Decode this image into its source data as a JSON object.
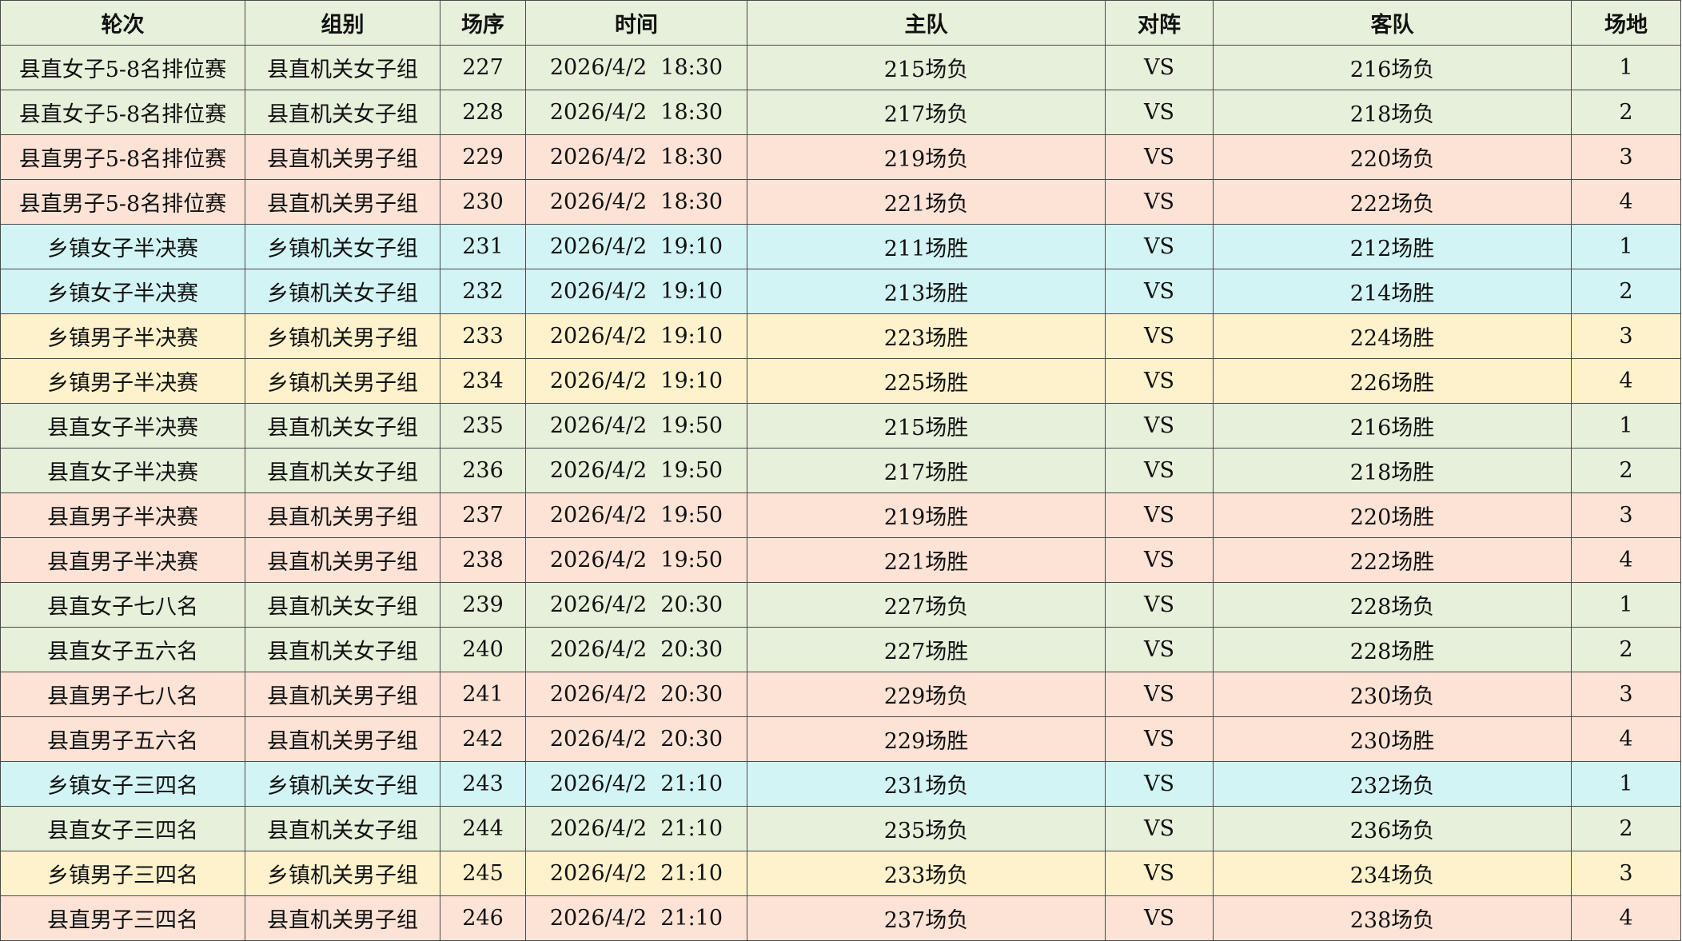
{
  "header": {
    "round": "轮次",
    "group": "组别",
    "match_no": "场序",
    "time": "时间",
    "home": "主队",
    "vs": "对阵",
    "away": "客队",
    "court": "场地"
  },
  "row_colors": {
    "xg-f": "#e6f0da",
    "xg-m": "#fce3d6",
    "xz-f": "#d3f4f4",
    "xz-m": "#fdf2cc"
  },
  "rows": [
    {
      "color": "xg-f",
      "round": "县直女子5-8名排位赛",
      "group": "县直机关女子组",
      "match_no": "227",
      "time": "2026/4/2  18:30",
      "home": "215场负",
      "vs": "VS",
      "away": "216场负",
      "court": "1"
    },
    {
      "color": "xg-f",
      "round": "县直女子5-8名排位赛",
      "group": "县直机关女子组",
      "match_no": "228",
      "time": "2026/4/2  18:30",
      "home": "217场负",
      "vs": "VS",
      "away": "218场负",
      "court": "2"
    },
    {
      "color": "xg-m",
      "round": "县直男子5-8名排位赛",
      "group": "县直机关男子组",
      "match_no": "229",
      "time": "2026/4/2  18:30",
      "home": "219场负",
      "vs": "VS",
      "away": "220场负",
      "court": "3"
    },
    {
      "color": "xg-m",
      "round": "县直男子5-8名排位赛",
      "group": "县直机关男子组",
      "match_no": "230",
      "time": "2026/4/2  18:30",
      "home": "221场负",
      "vs": "VS",
      "away": "222场负",
      "court": "4"
    },
    {
      "color": "xz-f",
      "round": "乡镇女子半决赛",
      "group": "乡镇机关女子组",
      "match_no": "231",
      "time": "2026/4/2  19:10",
      "home": "211场胜",
      "vs": "VS",
      "away": "212场胜",
      "court": "1"
    },
    {
      "color": "xz-f",
      "round": "乡镇女子半决赛",
      "group": "乡镇机关女子组",
      "match_no": "232",
      "time": "2026/4/2  19:10",
      "home": "213场胜",
      "vs": "VS",
      "away": "214场胜",
      "court": "2"
    },
    {
      "color": "xz-m",
      "round": "乡镇男子半决赛",
      "group": "乡镇机关男子组",
      "match_no": "233",
      "time": "2026/4/2  19:10",
      "home": "223场胜",
      "vs": "VS",
      "away": "224场胜",
      "court": "3"
    },
    {
      "color": "xz-m",
      "round": "乡镇男子半决赛",
      "group": "乡镇机关男子组",
      "match_no": "234",
      "time": "2026/4/2  19:10",
      "home": "225场胜",
      "vs": "VS",
      "away": "226场胜",
      "court": "4"
    },
    {
      "color": "xg-f",
      "round": "县直女子半决赛",
      "group": "县直机关女子组",
      "match_no": "235",
      "time": "2026/4/2  19:50",
      "home": "215场胜",
      "vs": "VS",
      "away": "216场胜",
      "court": "1"
    },
    {
      "color": "xg-f",
      "round": "县直女子半决赛",
      "group": "县直机关女子组",
      "match_no": "236",
      "time": "2026/4/2  19:50",
      "home": "217场胜",
      "vs": "VS",
      "away": "218场胜",
      "court": "2"
    },
    {
      "color": "xg-m",
      "round": "县直男子半决赛",
      "group": "县直机关男子组",
      "match_no": "237",
      "time": "2026/4/2  19:50",
      "home": "219场胜",
      "vs": "VS",
      "away": "220场胜",
      "court": "3"
    },
    {
      "color": "xg-m",
      "round": "县直男子半决赛",
      "group": "县直机关男子组",
      "match_no": "238",
      "time": "2026/4/2  19:50",
      "home": "221场胜",
      "vs": "VS",
      "away": "222场胜",
      "court": "4"
    },
    {
      "color": "xg-f",
      "round": "县直女子七八名",
      "group": "县直机关女子组",
      "match_no": "239",
      "time": "2026/4/2  20:30",
      "home": "227场负",
      "vs": "VS",
      "away": "228场负",
      "court": "1"
    },
    {
      "color": "xg-f",
      "round": "县直女子五六名",
      "group": "县直机关女子组",
      "match_no": "240",
      "time": "2026/4/2  20:30",
      "home": "227场胜",
      "vs": "VS",
      "away": "228场胜",
      "court": "2"
    },
    {
      "color": "xg-m",
      "round": "县直男子七八名",
      "group": "县直机关男子组",
      "match_no": "241",
      "time": "2026/4/2  20:30",
      "home": "229场负",
      "vs": "VS",
      "away": "230场负",
      "court": "3"
    },
    {
      "color": "xg-m",
      "round": "县直男子五六名",
      "group": "县直机关男子组",
      "match_no": "242",
      "time": "2026/4/2  20:30",
      "home": "229场胜",
      "vs": "VS",
      "away": "230场胜",
      "court": "4"
    },
    {
      "color": "xz-f",
      "round": "乡镇女子三四名",
      "group": "乡镇机关女子组",
      "match_no": "243",
      "time": "2026/4/2  21:10",
      "home": "231场负",
      "vs": "VS",
      "away": "232场负",
      "court": "1"
    },
    {
      "color": "xg-f",
      "round": "县直女子三四名",
      "group": "县直机关女子组",
      "match_no": "244",
      "time": "2026/4/2  21:10",
      "home": "235场负",
      "vs": "VS",
      "away": "236场负",
      "court": "2"
    },
    {
      "color": "xz-m",
      "round": "乡镇男子三四名",
      "group": "乡镇机关男子组",
      "match_no": "245",
      "time": "2026/4/2  21:10",
      "home": "233场负",
      "vs": "VS",
      "away": "234场负",
      "court": "3"
    },
    {
      "color": "xg-m",
      "round": "县直男子三四名",
      "group": "县直机关男子组",
      "match_no": "246",
      "time": "2026/4/2  21:10",
      "home": "237场负",
      "vs": "VS",
      "away": "238场负",
      "court": "4"
    }
  ]
}
